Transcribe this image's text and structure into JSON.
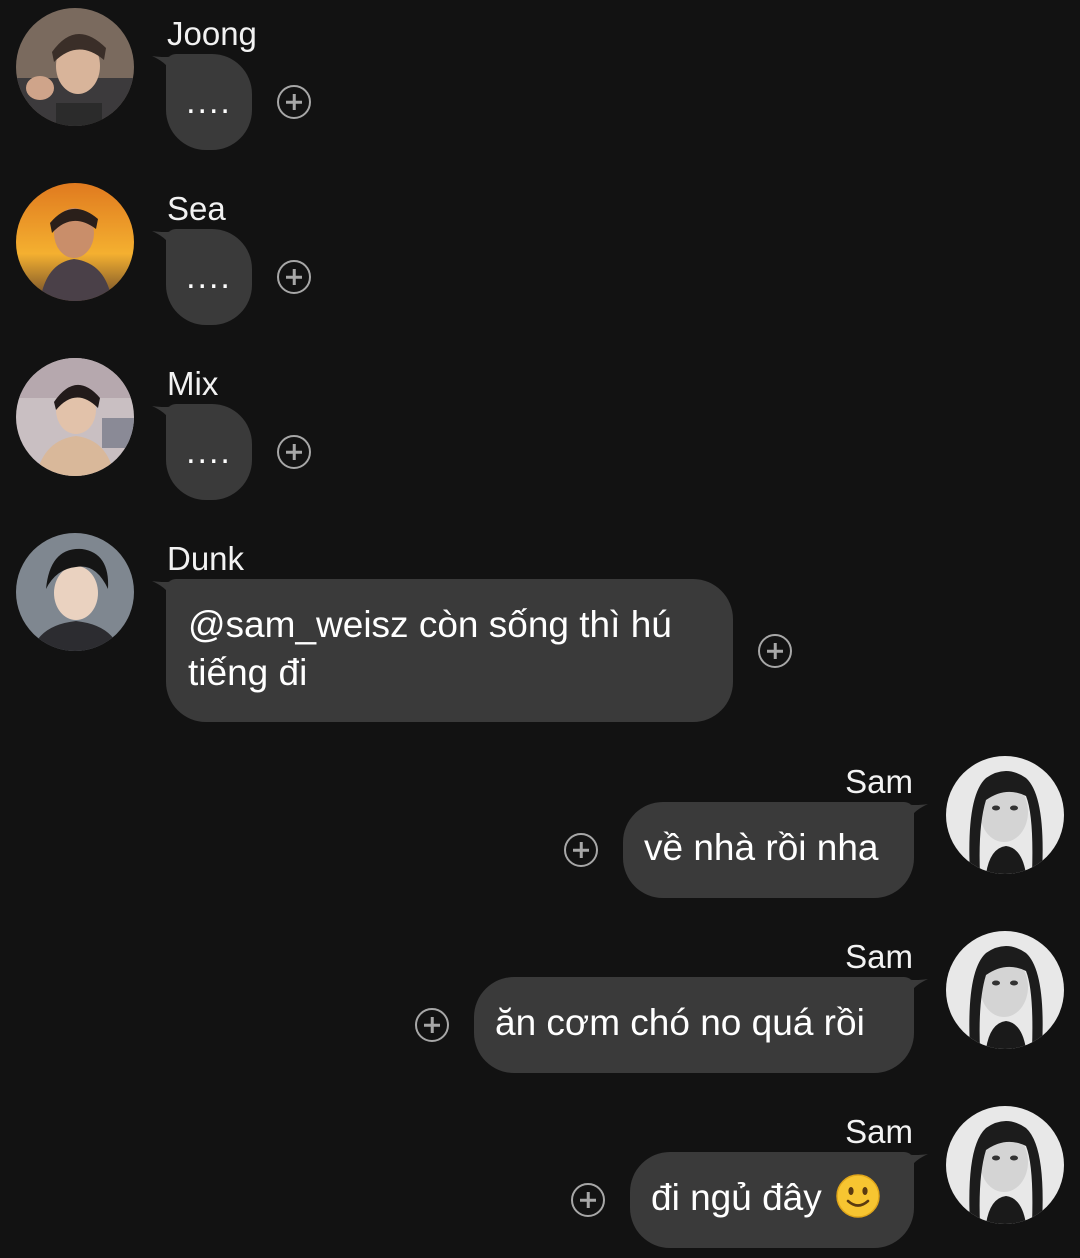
{
  "messages": [
    {
      "sender": "Joong",
      "text": "....",
      "avatar_icon": "avatar-joong-photo-icon"
    },
    {
      "sender": "Sea",
      "text": "....",
      "avatar_icon": "avatar-sea-photo-icon"
    },
    {
      "sender": "Mix",
      "text": "....",
      "avatar_icon": "avatar-mix-photo-icon"
    },
    {
      "sender": "Dunk",
      "text_line1": "@sam_weisz còn sống thì hú",
      "text_line2": "tiếng đi",
      "avatar_icon": "avatar-dunk-photo-icon"
    },
    {
      "sender": "Sam",
      "text": "về nhà rồi nha",
      "avatar_icon": "avatar-sam-photo-icon"
    },
    {
      "sender": "Sam",
      "text": "ăn cơm chó no quá rồi",
      "avatar_icon": "avatar-sam-photo-icon"
    },
    {
      "sender": "Sam",
      "text": "đi ngủ đây",
      "emoji_icon": "slightly-smiling-face-icon",
      "avatar_icon": "avatar-sam-photo-icon"
    }
  ],
  "colors": {
    "background": "#121212",
    "bubble": "#3a3a3a",
    "text": "#ffffff",
    "react_icon": "#a7a7a7"
  }
}
